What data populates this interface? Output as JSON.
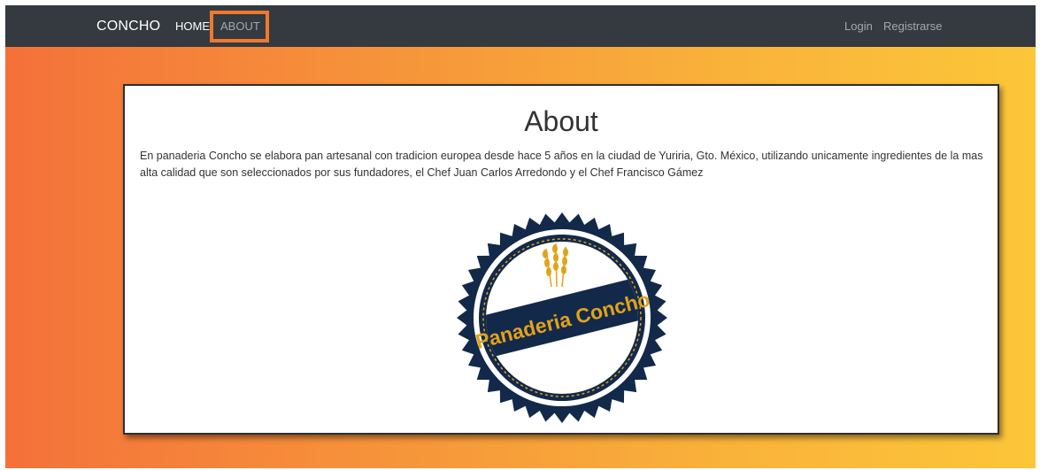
{
  "navbar": {
    "brand": "CONCHO",
    "links": [
      {
        "label": "HOME"
      },
      {
        "label": "ABOUT",
        "highlighted": true
      }
    ],
    "right_links": [
      {
        "label": "Login"
      },
      {
        "label": "Registrarse"
      }
    ]
  },
  "about": {
    "title": "About",
    "text": "En panaderia Concho se elabora pan artesanal con tradicion europea desde hace 5 años en la ciudad de Yuriria, Gto. México, utilizando unicamente ingredientes de la mas alta calidad que son seleccionados por sus fundadores, el Chef Juan Carlos Arredondo y el Chef Francisco Gámez"
  },
  "logo": {
    "text": "Panaderia Concho",
    "icon": "wheat-icon"
  },
  "colors": {
    "navbar_bg": "#343a40",
    "highlight": "#f1782d",
    "gradient_start": "#f4713a",
    "gradient_end": "#fcc639",
    "logo_navy": "#12294a",
    "logo_gold": "#e3a21a"
  }
}
